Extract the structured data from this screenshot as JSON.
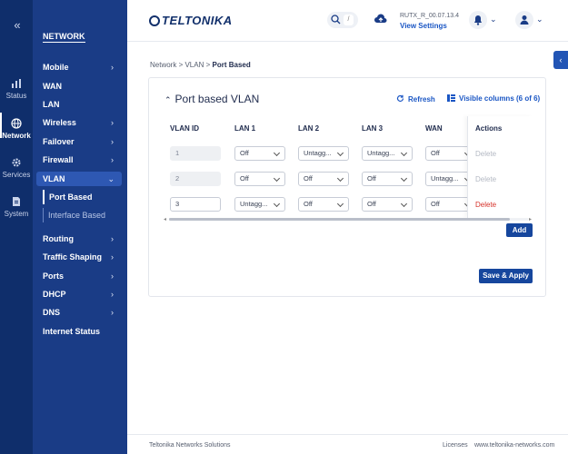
{
  "rail": {
    "collapse": "«",
    "items": [
      {
        "label": "Status",
        "icon": "status-chart-icon"
      },
      {
        "label": "Network",
        "icon": "globe-icon"
      },
      {
        "label": "Services",
        "icon": "gear-icon"
      },
      {
        "label": "System",
        "icon": "document-icon"
      }
    ]
  },
  "menu": {
    "section": "NETWORK",
    "items": [
      "Mobile",
      "WAN",
      "LAN",
      "Wireless",
      "Failover",
      "Firewall",
      "VLAN",
      "Routing",
      "Traffic Shaping",
      "Ports",
      "DHCP",
      "DNS",
      "Internet Status"
    ],
    "vlan_sub": [
      "Port Based",
      "Interface Based"
    ]
  },
  "header": {
    "logo": "TELTONIKA",
    "search_key": "/",
    "fw_version": "RUTX_R_00.07.13.4",
    "fw_link": "View Settings"
  },
  "breadcrumb": {
    "a": "Network",
    "b": "VLAN",
    "c": "Port Based"
  },
  "card": {
    "title": "Port based VLAN",
    "refresh": "Refresh",
    "visible_columns": "Visible columns (6 of 6)",
    "headers": [
      "VLAN ID",
      "LAN 1",
      "LAN 2",
      "LAN 3",
      "WAN",
      "Actions"
    ],
    "rows": [
      {
        "id": "1",
        "lan1": "Off",
        "lan2": "Untagg...",
        "lan3": "Untagg...",
        "wan": "Off",
        "action": "Delete"
      },
      {
        "id": "2",
        "lan1": "Off",
        "lan2": "Off",
        "lan3": "Off",
        "wan": "Untagg...",
        "action": "Delete"
      },
      {
        "id": "3",
        "lan1": "Untagg...",
        "lan2": "Off",
        "lan3": "Off",
        "wan": "Off",
        "action": "Delete"
      }
    ],
    "add": "Add",
    "save": "Save & Apply"
  },
  "footer": {
    "company": "Teltonika Networks Solutions",
    "licenses": "Licenses",
    "site": "www.teltonika-networks.com"
  },
  "colors": {
    "rail": "#0f2e6b",
    "menu": "#1a3c86",
    "accent": "#16469d",
    "danger": "#d6322a"
  }
}
